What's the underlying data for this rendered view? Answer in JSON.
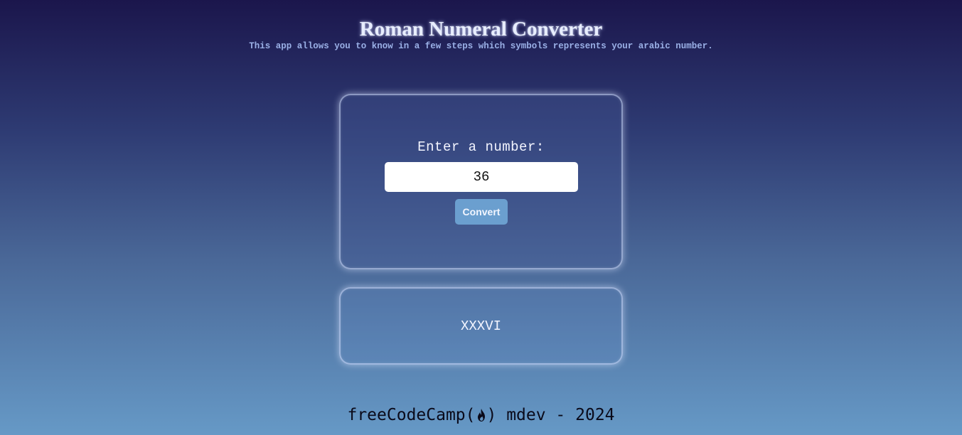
{
  "header": {
    "title": "Roman Numeral Converter",
    "subtitle": "This app allows you to know in a few steps which symbols represents your arabic number."
  },
  "form": {
    "label": "Enter a number:",
    "input_value": "36",
    "button_label": "Convert"
  },
  "output": {
    "result": "XXXVI"
  },
  "footer": {
    "prefix": "freeCodeCamp(",
    "icon": "fire-icon",
    "suffix": ") mdev - 2024"
  },
  "colors": {
    "background_top": "#1b164c",
    "background_bottom": "#6699c6",
    "button": "#6b9fcf"
  }
}
